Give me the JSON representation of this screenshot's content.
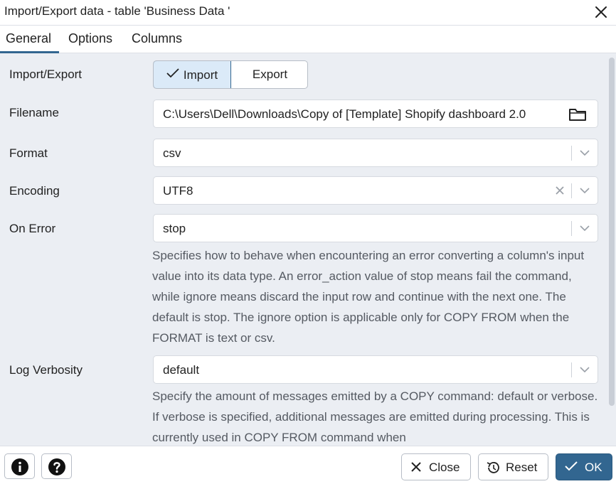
{
  "dialog": {
    "title": "Import/Export data - table 'Business Data '"
  },
  "tabs": [
    {
      "label": "General",
      "active": true
    },
    {
      "label": "Options",
      "active": false
    },
    {
      "label": "Columns",
      "active": false
    }
  ],
  "general": {
    "import_export": {
      "label": "Import/Export",
      "options": [
        "Import",
        "Export"
      ],
      "selected": "Import"
    },
    "filename": {
      "label": "Filename",
      "value": "C:\\Users\\Dell\\Downloads\\Copy of [Template] Shopify dashboard 2.0"
    },
    "format": {
      "label": "Format",
      "value": "csv"
    },
    "encoding": {
      "label": "Encoding",
      "value": "UTF8"
    },
    "on_error": {
      "label": "On Error",
      "value": "stop",
      "help": "Specifies how to behave when encountering an error converting a column's input value into its data type. An error_action value of stop means fail the command, while ignore means discard the input row and continue with the next one. The default is stop. The ignore option is applicable only for COPY FROM when the FORMAT is text or csv."
    },
    "log_verbosity": {
      "label": "Log Verbosity",
      "value": "default",
      "help": "Specify the amount of messages emitted by a COPY command: default or verbose. If verbose is specified, additional messages are emitted during processing. This is currently used in COPY FROM command when"
    }
  },
  "footer": {
    "close_label": "Close",
    "reset_label": "Reset",
    "ok_label": "OK"
  },
  "colors": {
    "primary": "#326690",
    "selected_bg": "#dbeaf8",
    "panel_bg": "#ebeef3"
  },
  "icons": {
    "close": "close-icon",
    "check": "check-icon",
    "folder": "folder-icon",
    "chevron": "chevron-down-icon",
    "clear": "clear-icon",
    "info": "info-icon",
    "help": "help-icon",
    "reset": "reset-icon"
  }
}
